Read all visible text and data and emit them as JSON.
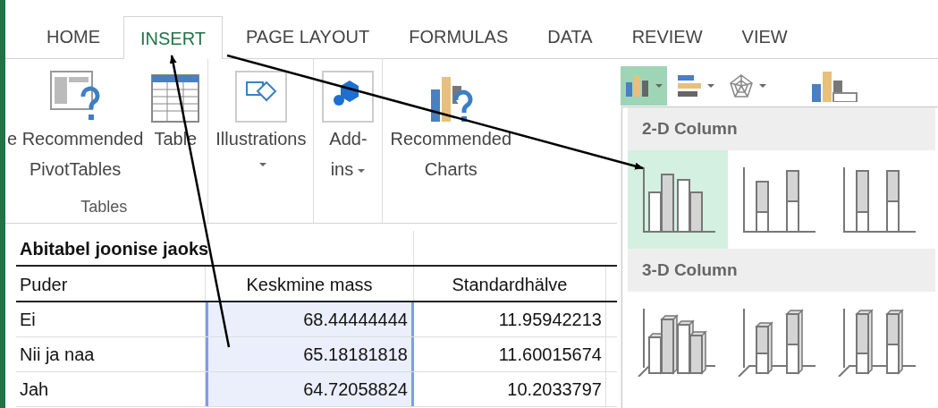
{
  "tabs": [
    {
      "label": "HOME",
      "selected": false
    },
    {
      "label": "INSERT",
      "selected": true
    },
    {
      "label": "PAGE LAYOUT",
      "selected": false
    },
    {
      "label": "FORMULAS",
      "selected": false
    },
    {
      "label": "DATA",
      "selected": false
    },
    {
      "label": "REVIEW",
      "selected": false
    },
    {
      "label": "VIEW",
      "selected": false
    }
  ],
  "ribbon": {
    "groups": [
      {
        "label": "Tables",
        "buttons": [
          {
            "kind": "pivot",
            "lines": [
              "e Recommended",
              "PivotTables"
            ],
            "dropdown": false
          },
          {
            "kind": "table",
            "lines": [
              "Table"
            ],
            "dropdown": false
          }
        ]
      },
      {
        "buttons": [
          {
            "kind": "illustrations",
            "lines": [
              "Illustrations"
            ],
            "dropdown": true
          }
        ]
      },
      {
        "buttons": [
          {
            "kind": "addins",
            "lines": [
              "Add-",
              "ins"
            ],
            "dropdown": true
          }
        ]
      },
      {
        "buttons": [
          {
            "kind": "charts",
            "lines": [
              "Recommended",
              "Charts"
            ],
            "dropdown": false
          }
        ]
      }
    ],
    "chart_buttons": [
      {
        "kind": "column",
        "selected": true,
        "dropdown": true
      },
      {
        "kind": "bar",
        "selected": false,
        "dropdown": true
      },
      {
        "kind": "radar",
        "selected": false,
        "dropdown": true
      },
      {
        "kind": "pivotchart",
        "selected": false,
        "dropdown": false
      }
    ]
  },
  "sheet": {
    "title": "Abitabel joonise jaoks",
    "columns": [
      "Puder",
      "Keskmine mass",
      "Standardhälve"
    ],
    "rows": [
      {
        "cells": [
          {
            "text": "Ei",
            "selected": false
          },
          {
            "text": "68.44444444",
            "selected": true
          },
          {
            "text": "11.95942213",
            "selected": false
          }
        ]
      },
      {
        "cells": [
          {
            "text": "Nii ja naa",
            "selected": false
          },
          {
            "text": "65.18181818",
            "selected": true
          },
          {
            "text": "11.60015674",
            "selected": false
          }
        ]
      },
      {
        "cells": [
          {
            "text": "Jah",
            "selected": false
          },
          {
            "text": "64.72058824",
            "selected": true
          },
          {
            "text": "10.2033797",
            "selected": false
          }
        ]
      }
    ]
  },
  "dropdown": {
    "sections": [
      {
        "title": "2-D Column",
        "options": [
          {
            "kind": "clustered",
            "selected": true
          },
          {
            "kind": "stacked",
            "selected": false
          },
          {
            "kind": "stacked100",
            "selected": false
          }
        ]
      },
      {
        "title": "3-D Column",
        "options": [
          {
            "kind": "clustered3d",
            "selected": false
          },
          {
            "kind": "stacked3d",
            "selected": false
          },
          {
            "kind": "stacked100_3d",
            "selected": false
          }
        ]
      }
    ]
  }
}
